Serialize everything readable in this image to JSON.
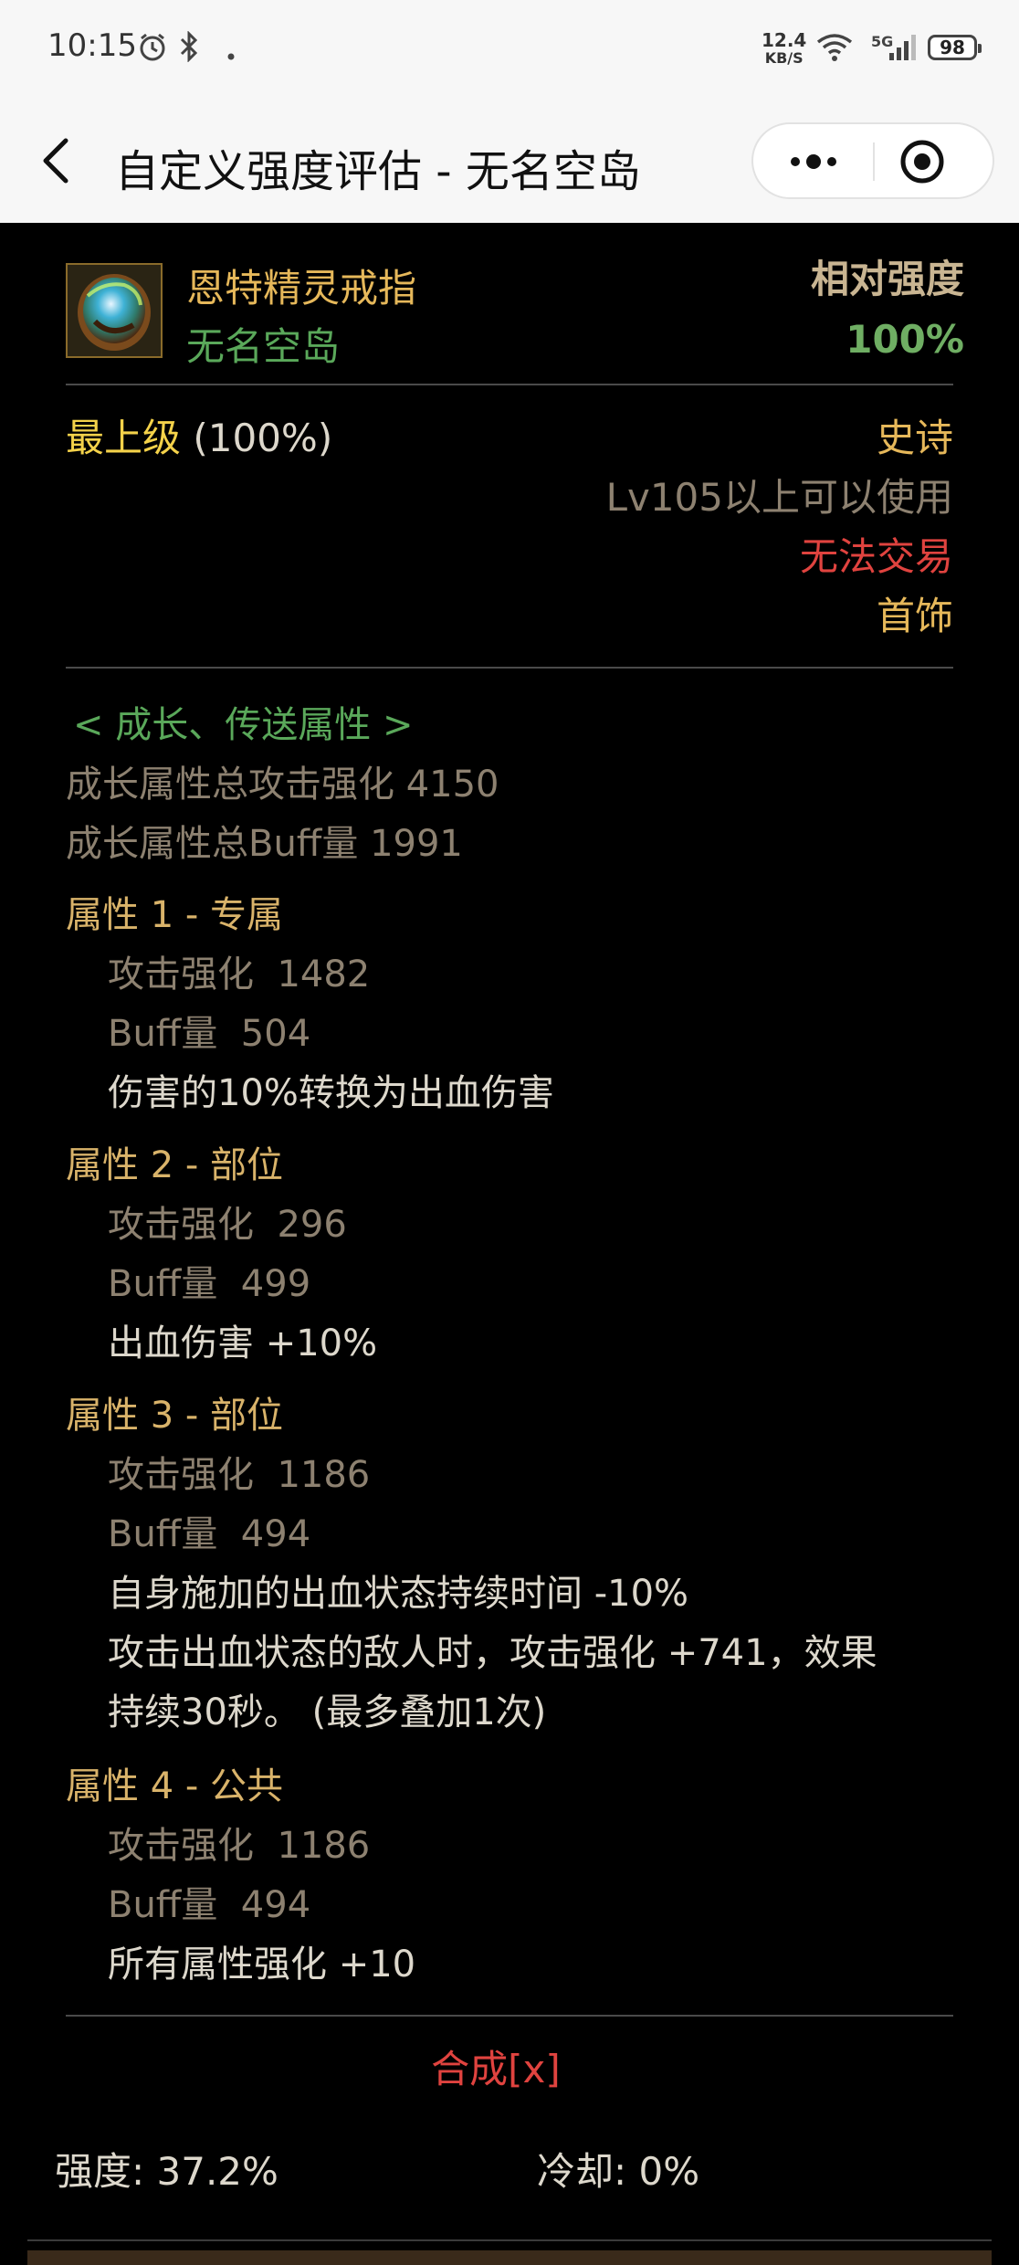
{
  "status_bar": {
    "time": "10:15",
    "net_speed_value": "12.4",
    "net_speed_unit": "KB/S",
    "network": "5G",
    "battery": "98"
  },
  "nav": {
    "title": "自定义强度评估 - 无名空岛"
  },
  "item": {
    "name": "恩特精灵戒指",
    "set_name": "无名空岛",
    "relative_strength_label": "相对强度",
    "relative_strength_value": "100%",
    "grade_label": "最上级",
    "grade_percent": "(100%)",
    "rarity": "史诗",
    "level_req": "Lv105以上可以使用",
    "trade": "无法交易",
    "slot": "首饰"
  },
  "growth": {
    "header": "< 成长、传送属性 >",
    "total_attack": "成长属性总攻击强化 4150",
    "total_buff": "成长属性总Buff量 1991",
    "attributes": [
      {
        "title": "属性 1 - 专属",
        "attack_label": "攻击强化",
        "attack_value": "1482",
        "buff_label": "Buff量",
        "buff_value": "504",
        "effects": [
          "伤害的10%转换为出血伤害"
        ]
      },
      {
        "title": "属性 2 - 部位",
        "attack_label": "攻击强化",
        "attack_value": "296",
        "buff_label": "Buff量",
        "buff_value": "499",
        "effects": [
          "出血伤害 +10%"
        ]
      },
      {
        "title": "属性 3 - 部位",
        "attack_label": "攻击强化",
        "attack_value": "1186",
        "buff_label": "Buff量",
        "buff_value": "494",
        "effects": [
          "自身施加的出血状态持续时间 -10%",
          "攻击出血状态的敌人时，攻击强化 +741，效果",
          "持续30秒。 (最多叠加1次)"
        ]
      },
      {
        "title": "属性 4 - 公共",
        "attack_label": "攻击强化",
        "attack_value": "1186",
        "buff_label": "Buff量",
        "buff_value": "494",
        "effects": [
          "所有属性强化 +10"
        ]
      }
    ]
  },
  "fusion_link": "合成[x]",
  "footer": {
    "strength": "强度: 37.2%",
    "cooldown": "冷却: 0%"
  },
  "colors": {
    "background": "#000000",
    "gold": "#e6b85a",
    "green": "#5aa85a",
    "red": "#e0433f",
    "grey": "#8d8170"
  }
}
